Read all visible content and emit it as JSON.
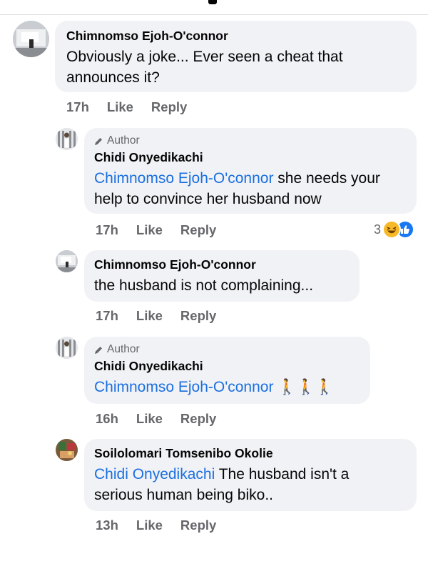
{
  "comments": [
    {
      "name": "Chimnomso Ejoh-O'connor",
      "text": "Obviously a joke... Ever seen a cheat that announces it?",
      "time": "17h",
      "like": "Like",
      "reply": "Reply"
    },
    {
      "author_tag": "Author",
      "name": "Chidi Onyedikachi",
      "mention": "Chimnomso Ejoh-O'connor",
      "text": " she needs your help to convince her husband now",
      "time": "17h",
      "like": "Like",
      "reply": "Reply",
      "reaction_count": "3"
    },
    {
      "name": "Chimnomso Ejoh-O'connor",
      "text": "the husband is not complaining...",
      "time": "17h",
      "like": "Like",
      "reply": "Reply"
    },
    {
      "author_tag": "Author",
      "name": "Chidi Onyedikachi",
      "mention": "Chimnomso Ejoh-O'connor",
      "emojis": "🚶🚶🚶",
      "time": "16h",
      "like": "Like",
      "reply": "Reply"
    },
    {
      "name": "Soilolomari Tomsenibo Okolie",
      "mention": "Chidi Onyedikachi",
      "text": " The husband isn't a serious human being biko..",
      "time": "13h",
      "like": "Like",
      "reply": "Reply"
    }
  ],
  "icons": {
    "author": "pencil-icon",
    "reactions": [
      "haha-reaction-icon",
      "like-reaction-icon"
    ]
  },
  "colors": {
    "bubble": "#f0f2f5",
    "mention": "#1b6fe0",
    "secondary_text": "#65676b"
  }
}
